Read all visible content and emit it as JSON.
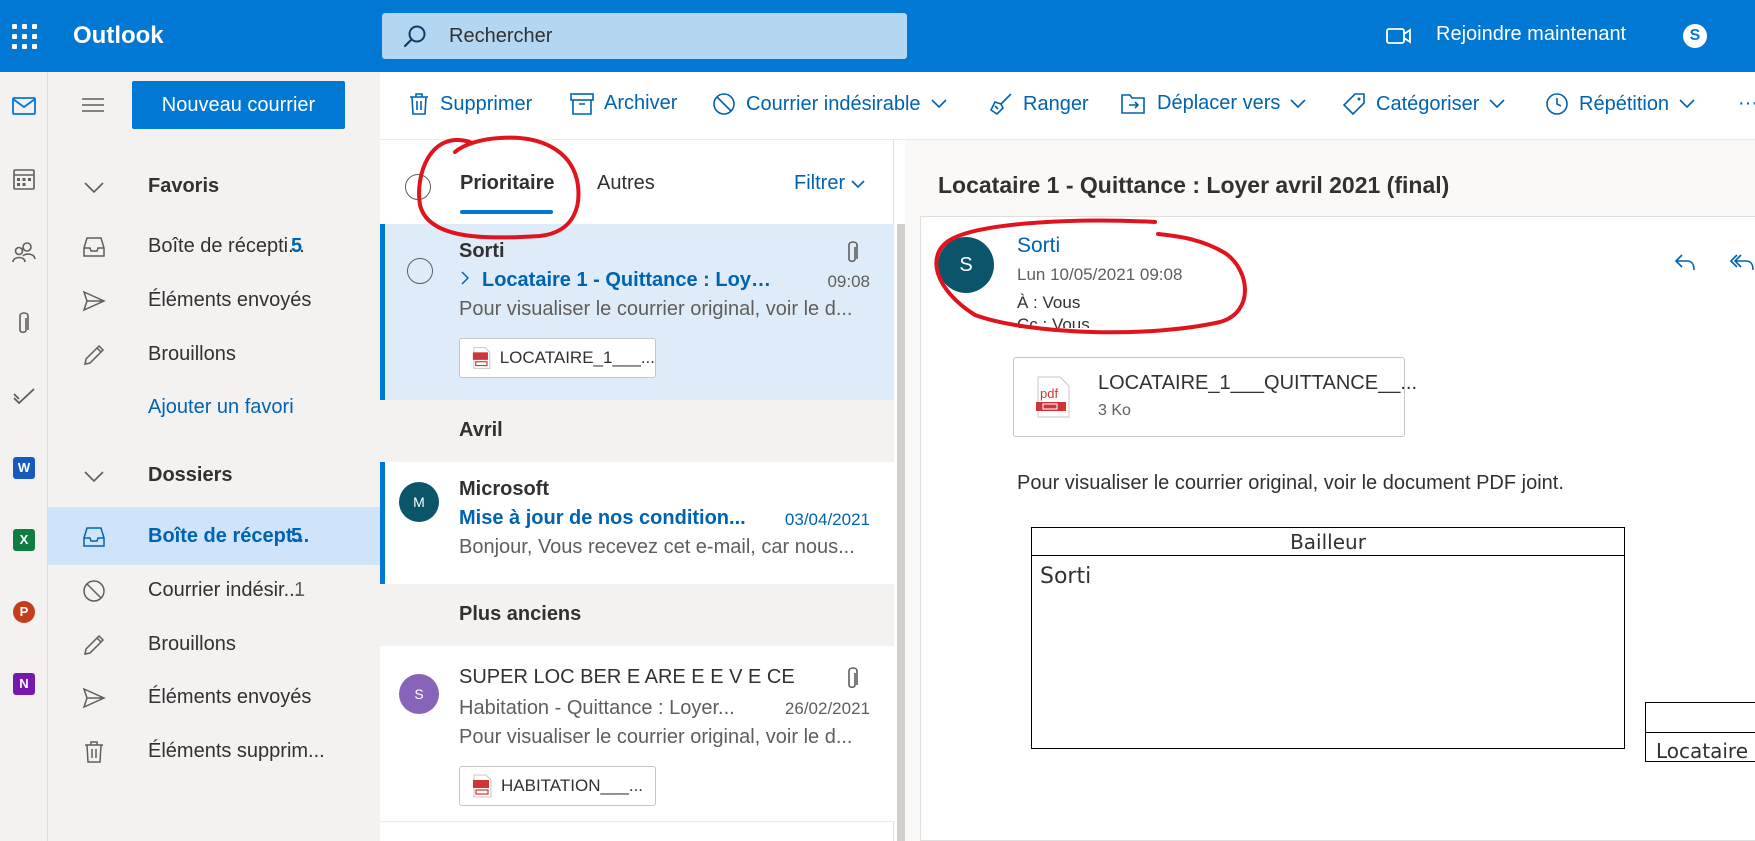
{
  "header": {
    "app_title": "Outlook",
    "search_placeholder": "Rechercher",
    "join_label": "Rejoindre maintenant",
    "skype_label": "S"
  },
  "rail": {
    "icons": [
      "mail-icon",
      "calendar-icon",
      "people-icon",
      "attachment-icon",
      "todo-icon",
      "word-icon",
      "excel-icon",
      "powerpoint-icon",
      "onenote-icon"
    ],
    "badges": {
      "word": "W",
      "excel": "X",
      "powerpoint": "P",
      "onenote": "N"
    },
    "badge_colors": {
      "word": "#185abd",
      "excel": "#107c41",
      "powerpoint": "#c43e1c",
      "onenote": "#7719aa"
    }
  },
  "folders": {
    "new_mail_label": "Nouveau courrier",
    "favorites_label": "Favoris",
    "favorites": [
      {
        "label": "Boîte de récepti...",
        "count": "5"
      },
      {
        "label": "Éléments envoyés",
        "count": ""
      },
      {
        "label": "Brouillons",
        "count": ""
      }
    ],
    "add_favorite": "Ajouter un favori",
    "folders_label": "Dossiers",
    "folder_items": [
      {
        "label": "Boîte de récept...",
        "count": "5"
      },
      {
        "label": "Courrier indésir...",
        "count": "1"
      },
      {
        "label": "Brouillons",
        "count": ""
      },
      {
        "label": "Éléments envoyés",
        "count": ""
      },
      {
        "label": "Éléments supprim...",
        "count": ""
      }
    ]
  },
  "toolbar": {
    "delete": "Supprimer",
    "archive": "Archiver",
    "junk": "Courrier indésirable",
    "sweep": "Ranger",
    "move": "Déplacer vers",
    "categorize": "Catégoriser",
    "snooze": "Répétition",
    "more": "···"
  },
  "list": {
    "tab_focused": "Prioritaire",
    "tab_other": "Autres",
    "filter": "Filtrer",
    "messages": [
      {
        "sender": "Sorti",
        "subject": "Locataire 1 - Quittance : Loyer a...",
        "time": "09:08",
        "preview": "Pour visualiser le courrier original, voir le d...",
        "attachment": "LOCATAIRE_1___..."
      },
      {
        "group": "Avril",
        "sender": "Microsoft",
        "avatar": "M",
        "avatar_color": "#0b556a",
        "subject": "Mise à jour de nos condition...",
        "time": "03/04/2021",
        "preview": "Bonjour, Vous recevez cet e-mail, car nous..."
      },
      {
        "group": "Plus anciens",
        "sender": "SUPER LOC BER E ARE E E V E CE",
        "avatar": "S",
        "avatar_color": "#8764b8",
        "subject": "Habitation - Quittance : Loyer...",
        "time": "26/02/2021",
        "preview": "Pour visualiser le courrier original, voir le d...",
        "attachment": "HABITATION___..."
      }
    ]
  },
  "reading": {
    "subject": "Locataire 1 - Quittance : Loyer avril 2021 (final)",
    "avatar": "S",
    "sender": "Sorti",
    "date": "Lun 10/05/2021 09:08",
    "to": "À :  Vous",
    "cc": "Cc :  Vous",
    "attachment_name": "LOCATAIRE_1___QUITTANCE__...",
    "attachment_size": "3 Ko",
    "body": "Pour visualiser le courrier original, voir le document PDF joint.",
    "table_header": "Bailleur",
    "table_cell": "Sorti",
    "table2_cell": "Locataire"
  },
  "colors": {
    "brand": "#0078d4",
    "annotation": "#e0141e"
  }
}
